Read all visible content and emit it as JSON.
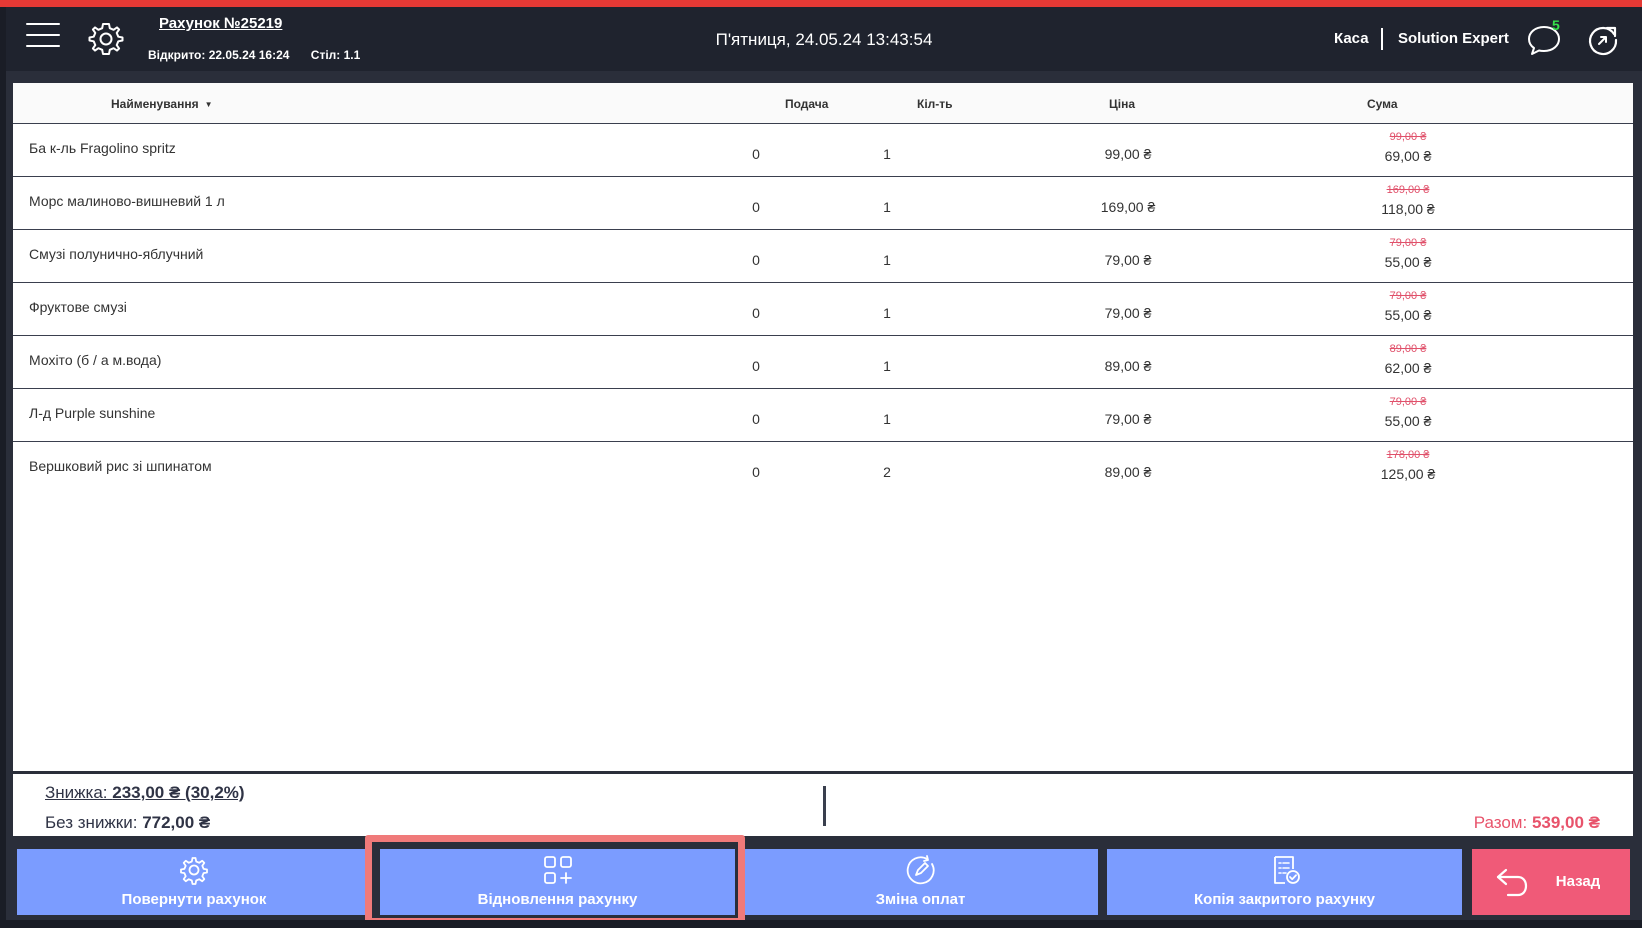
{
  "header": {
    "bill_title": "Рахунок №25219",
    "opened": "Відкрито: 22.05.24 16:24",
    "table": "Стіл: 1.1",
    "datetime": "П'ятниця, 24.05.24 13:43:54",
    "kasa": "Каса",
    "user": "Solution Expert",
    "chat_count": "5"
  },
  "columns": {
    "name": "Найменування",
    "serve": "Подача",
    "qty": "Кіл-ть",
    "price": "Ціна",
    "sum": "Сума"
  },
  "items": [
    {
      "name": "Ба к-ль Fragolino spritz",
      "serve": "0",
      "qty": "1",
      "price": "99,00 ₴",
      "old_sum": "99,00 ₴",
      "sum": "69,00 ₴"
    },
    {
      "name": "Морс малиново-вишневий 1 л",
      "serve": "0",
      "qty": "1",
      "price": "169,00 ₴",
      "old_sum": "169,00 ₴",
      "sum": "118,00 ₴"
    },
    {
      "name": "Смузі полунично-яблучний",
      "serve": "0",
      "qty": "1",
      "price": "79,00 ₴",
      "old_sum": "79,00 ₴",
      "sum": "55,00 ₴"
    },
    {
      "name": "Фруктове смузі",
      "serve": "0",
      "qty": "1",
      "price": "79,00 ₴",
      "old_sum": "79,00 ₴",
      "sum": "55,00 ₴"
    },
    {
      "name": "Мохіто (б / а м.вода)",
      "serve": "0",
      "qty": "1",
      "price": "89,00 ₴",
      "old_sum": "89,00 ₴",
      "sum": "62,00 ₴"
    },
    {
      "name": "Л-д Purple sunshine",
      "serve": "0",
      "qty": "1",
      "price": "79,00 ₴",
      "old_sum": "79,00 ₴",
      "sum": "55,00 ₴"
    },
    {
      "name": "Вершковий рис зі шпинатом",
      "serve": "0",
      "qty": "2",
      "price": "89,00 ₴",
      "old_sum": "178,00 ₴",
      "sum": "125,00 ₴"
    }
  ],
  "summary": {
    "discount_label": "Знижка: ",
    "discount_value": "233,00 ₴ (30,2%)",
    "no_discount_label": "Без знижки: ",
    "no_discount_value": "772,00 ₴",
    "total_label": "Разом: ",
    "total_value": "539,00 ₴"
  },
  "buttons": {
    "return_bill": "Повернути рахунок",
    "restore_bill": "Відновлення рахунку",
    "change_payments": "Зміна оплат",
    "copy_closed": "Копія закритого рахунку",
    "back": "Назад"
  },
  "colors": {
    "header_bg": "#1f232e",
    "button_blue": "#7b9cff",
    "button_back": "#f05a78",
    "discount_red": "#e0506a",
    "highlight": "#f07a7a",
    "badge_green": "#35e04a"
  }
}
